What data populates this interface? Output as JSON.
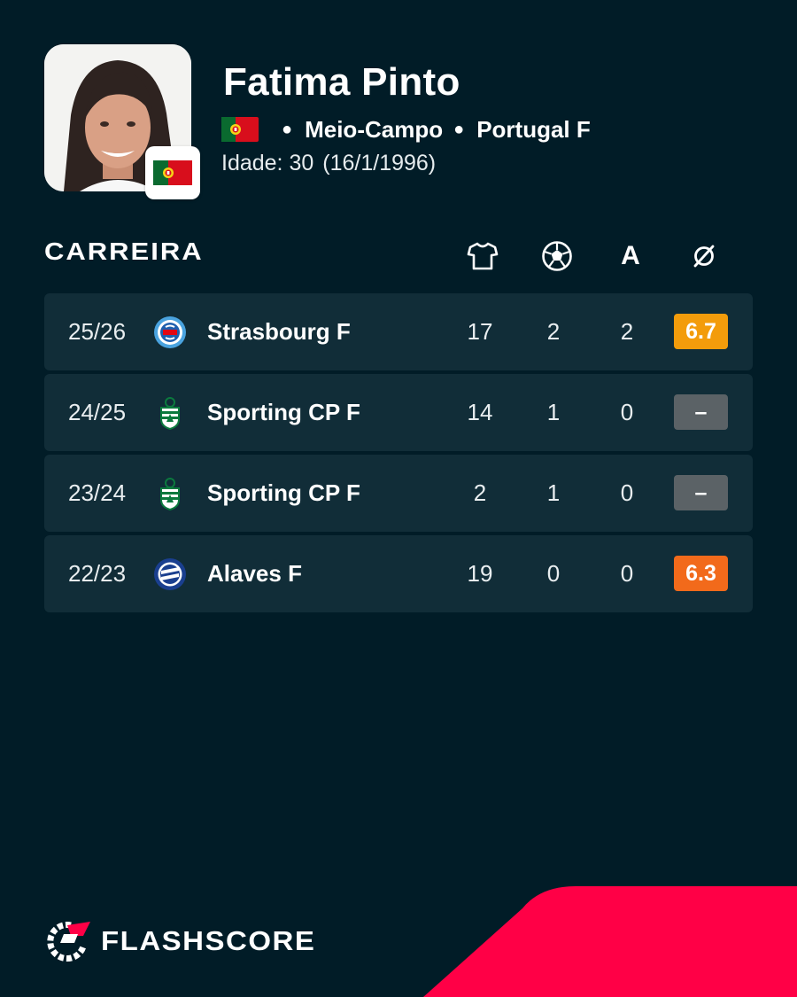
{
  "player": {
    "name": "Fatima Pinto",
    "position": "Meio-Campo",
    "team": "Portugal F",
    "age_label": "Idade: 30",
    "birth_date": "(16/1/1996)",
    "nationality_flag": "portugal-flag-icon"
  },
  "career": {
    "title": "CARREIRA",
    "columns": [
      {
        "name": "appearances",
        "icon": "shirt-icon"
      },
      {
        "name": "goals",
        "icon": "football-icon"
      },
      {
        "name": "assists",
        "icon": "assists-icon",
        "text": "A"
      },
      {
        "name": "average-rating",
        "icon": "average-icon"
      }
    ],
    "rows": [
      {
        "season": "25/26",
        "team": "Strasbourg F",
        "crest": "strasbourg-crest-icon",
        "apps": "17",
        "goals": "2",
        "assists": "2",
        "rating": "6.7",
        "rating_color": "#f39c0b"
      },
      {
        "season": "24/25",
        "team": "Sporting CP F",
        "crest": "sporting-crest-icon",
        "apps": "14",
        "goals": "1",
        "assists": "0",
        "rating": "–",
        "rating_color": "#5b6266"
      },
      {
        "season": "23/24",
        "team": "Sporting CP F",
        "crest": "sporting-crest-icon",
        "apps": "2",
        "goals": "1",
        "assists": "0",
        "rating": "–",
        "rating_color": "#5b6266"
      },
      {
        "season": "22/23",
        "team": "Alaves F",
        "crest": "alaves-crest-icon",
        "apps": "19",
        "goals": "0",
        "assists": "0",
        "rating": "6.3",
        "rating_color": "#f26a1b"
      }
    ]
  },
  "brand": {
    "name": "FLASHSCORE",
    "accent": "#ff0046",
    "background": "#011c27"
  }
}
